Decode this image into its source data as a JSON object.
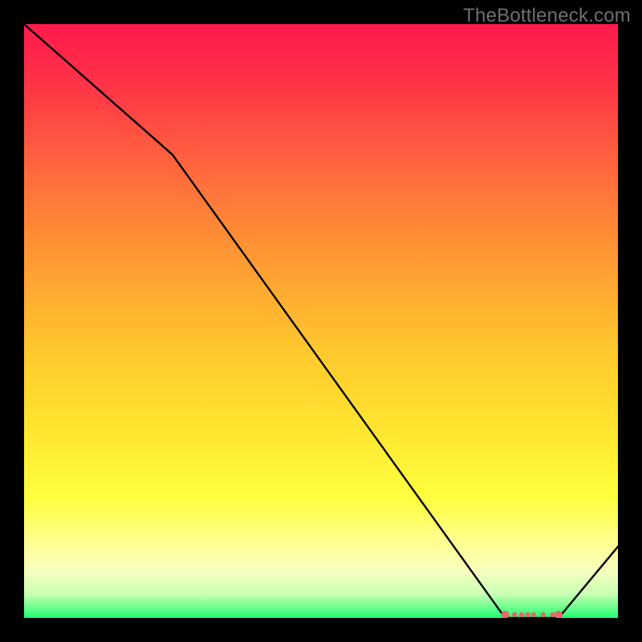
{
  "watermark": "TheBottleneck.com",
  "chart_data": {
    "type": "line",
    "title": "",
    "xlabel": "",
    "ylabel": "",
    "xlim": [
      0,
      100
    ],
    "ylim": [
      0,
      100
    ],
    "grid": false,
    "legend": false,
    "background": "red-green-vertical-gradient",
    "series": [
      {
        "name": "curve",
        "x": [
          0,
          25,
          81,
          90,
          100
        ],
        "values": [
          100,
          78,
          0,
          0,
          12
        ]
      }
    ],
    "markers": {
      "name": "optimal-zone-markers",
      "points": [
        {
          "x": 81.0,
          "y": 0
        },
        {
          "x": 82.6,
          "y": 0
        },
        {
          "x": 83.8,
          "y": 0
        },
        {
          "x": 84.8,
          "y": 0
        },
        {
          "x": 85.8,
          "y": 0
        },
        {
          "x": 87.4,
          "y": 0
        },
        {
          "x": 89.0,
          "y": 0
        },
        {
          "x": 90.0,
          "y": 0
        }
      ]
    }
  }
}
